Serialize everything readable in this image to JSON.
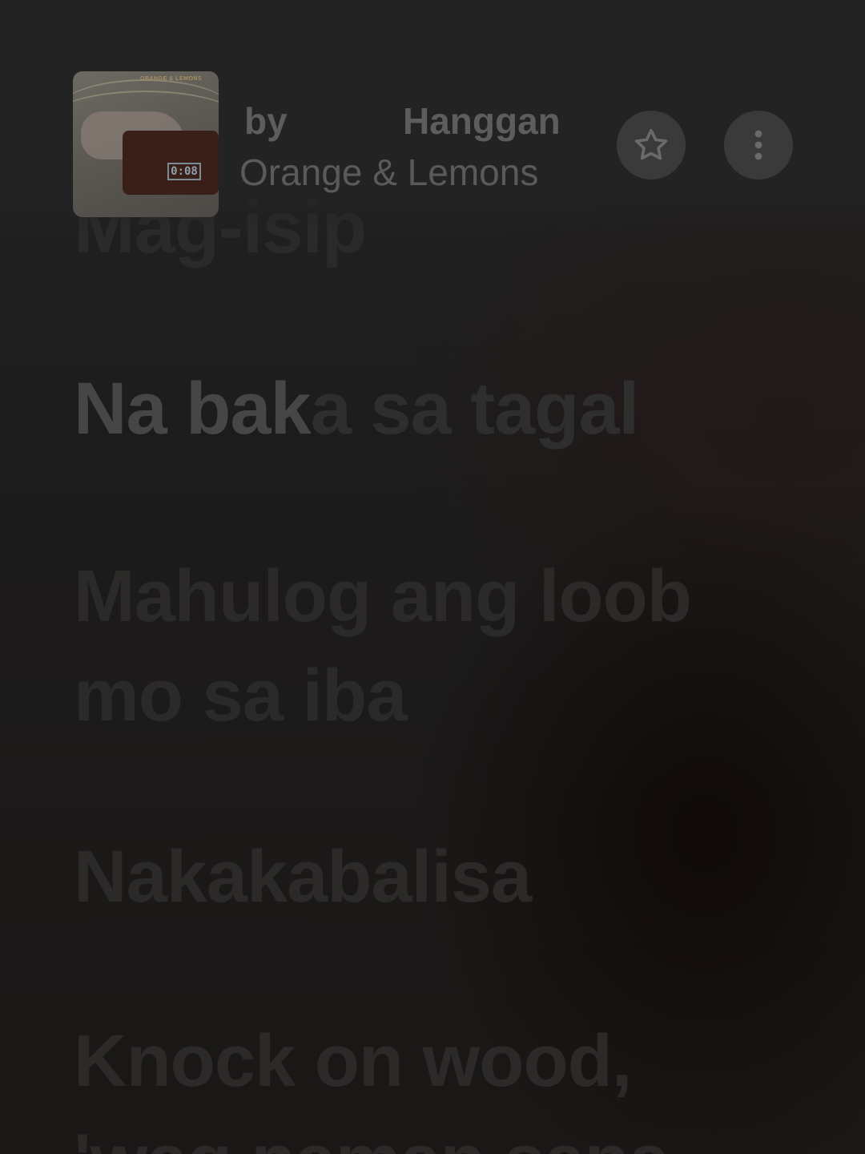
{
  "now_playing": {
    "by_label": "by",
    "title": "Hanggan",
    "artist": "Orange & Lemons",
    "album_art": {
      "icon": "album-cover",
      "clock_text": "0:08",
      "cover_text": "ORANGE & LEMONS"
    },
    "actions": {
      "favorite_icon": "star-outline-icon",
      "more_icon": "more-vertical-icon"
    }
  },
  "lyrics": {
    "previous_line": "Mag-isip",
    "active_line": {
      "sung": "Na bak",
      "unsung": "a sa tagal"
    },
    "upcoming_lines": [
      "Mahulog ang loob",
      "mo sa iba",
      "Nakakabalisa",
      "Knock on wood,",
      "'wag naman sana"
    ]
  },
  "colors": {
    "background": "#1a1a1a",
    "active_sung": "#474646",
    "active_unsung": "#2f2e2e",
    "dim_line": "#2b2a29",
    "meta_text": "#5d5d5d"
  }
}
